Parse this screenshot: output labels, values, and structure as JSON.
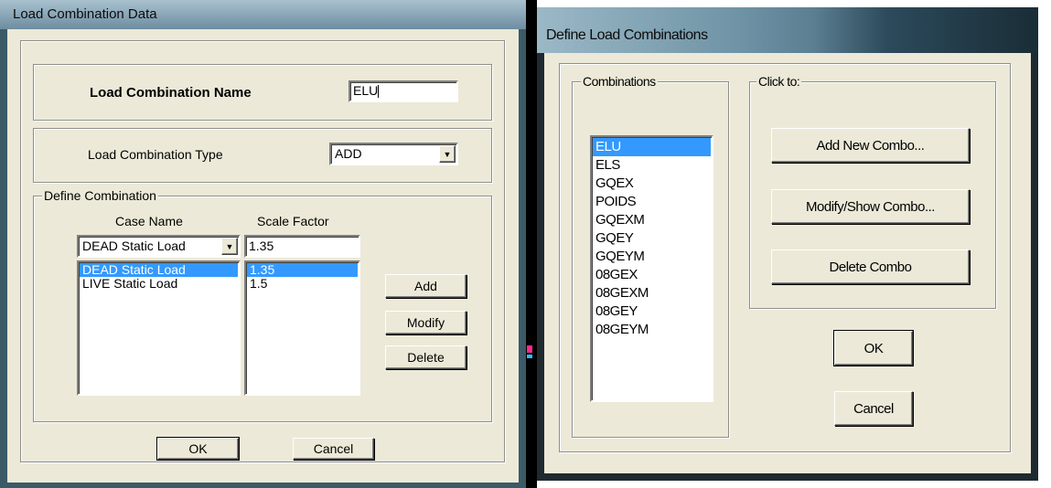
{
  "left_dialog": {
    "title": "Load Combination Data",
    "name_label": "Load Combination Name",
    "name_value": "ELU",
    "type_label": "Load Combination Type",
    "type_value": "ADD",
    "define_group": "Define Combination",
    "col_case": "Case Name",
    "col_scale": "Scale Factor",
    "case_select": "DEAD Static Load",
    "scale_input": "1.35",
    "cases": [
      "DEAD Static Load",
      "LIVE Static Load"
    ],
    "factors": [
      "1.35",
      "1.5"
    ],
    "add": "Add",
    "modify": "Modify",
    "delete": "Delete",
    "ok": "OK",
    "cancel": "Cancel"
  },
  "right_dialog": {
    "title": "Define Load Combinations",
    "combinations_group": "Combinations",
    "click_group": "Click to:",
    "combinations": [
      "ELU",
      "ELS",
      "GQEX",
      "POIDS",
      "GQEXM",
      "GQEY",
      "GQEYM",
      "08GEX",
      "08GEXM",
      "08GEY",
      "08GEYM"
    ],
    "add_new": "Add New Combo...",
    "modify_show": "Modify/Show Combo...",
    "delete_combo": "Delete Combo",
    "ok": "OK",
    "cancel": "Cancel"
  },
  "colors": {
    "face": "#ece9d8",
    "selection": "#3399ff",
    "title_bg": "#7a9bb0"
  }
}
